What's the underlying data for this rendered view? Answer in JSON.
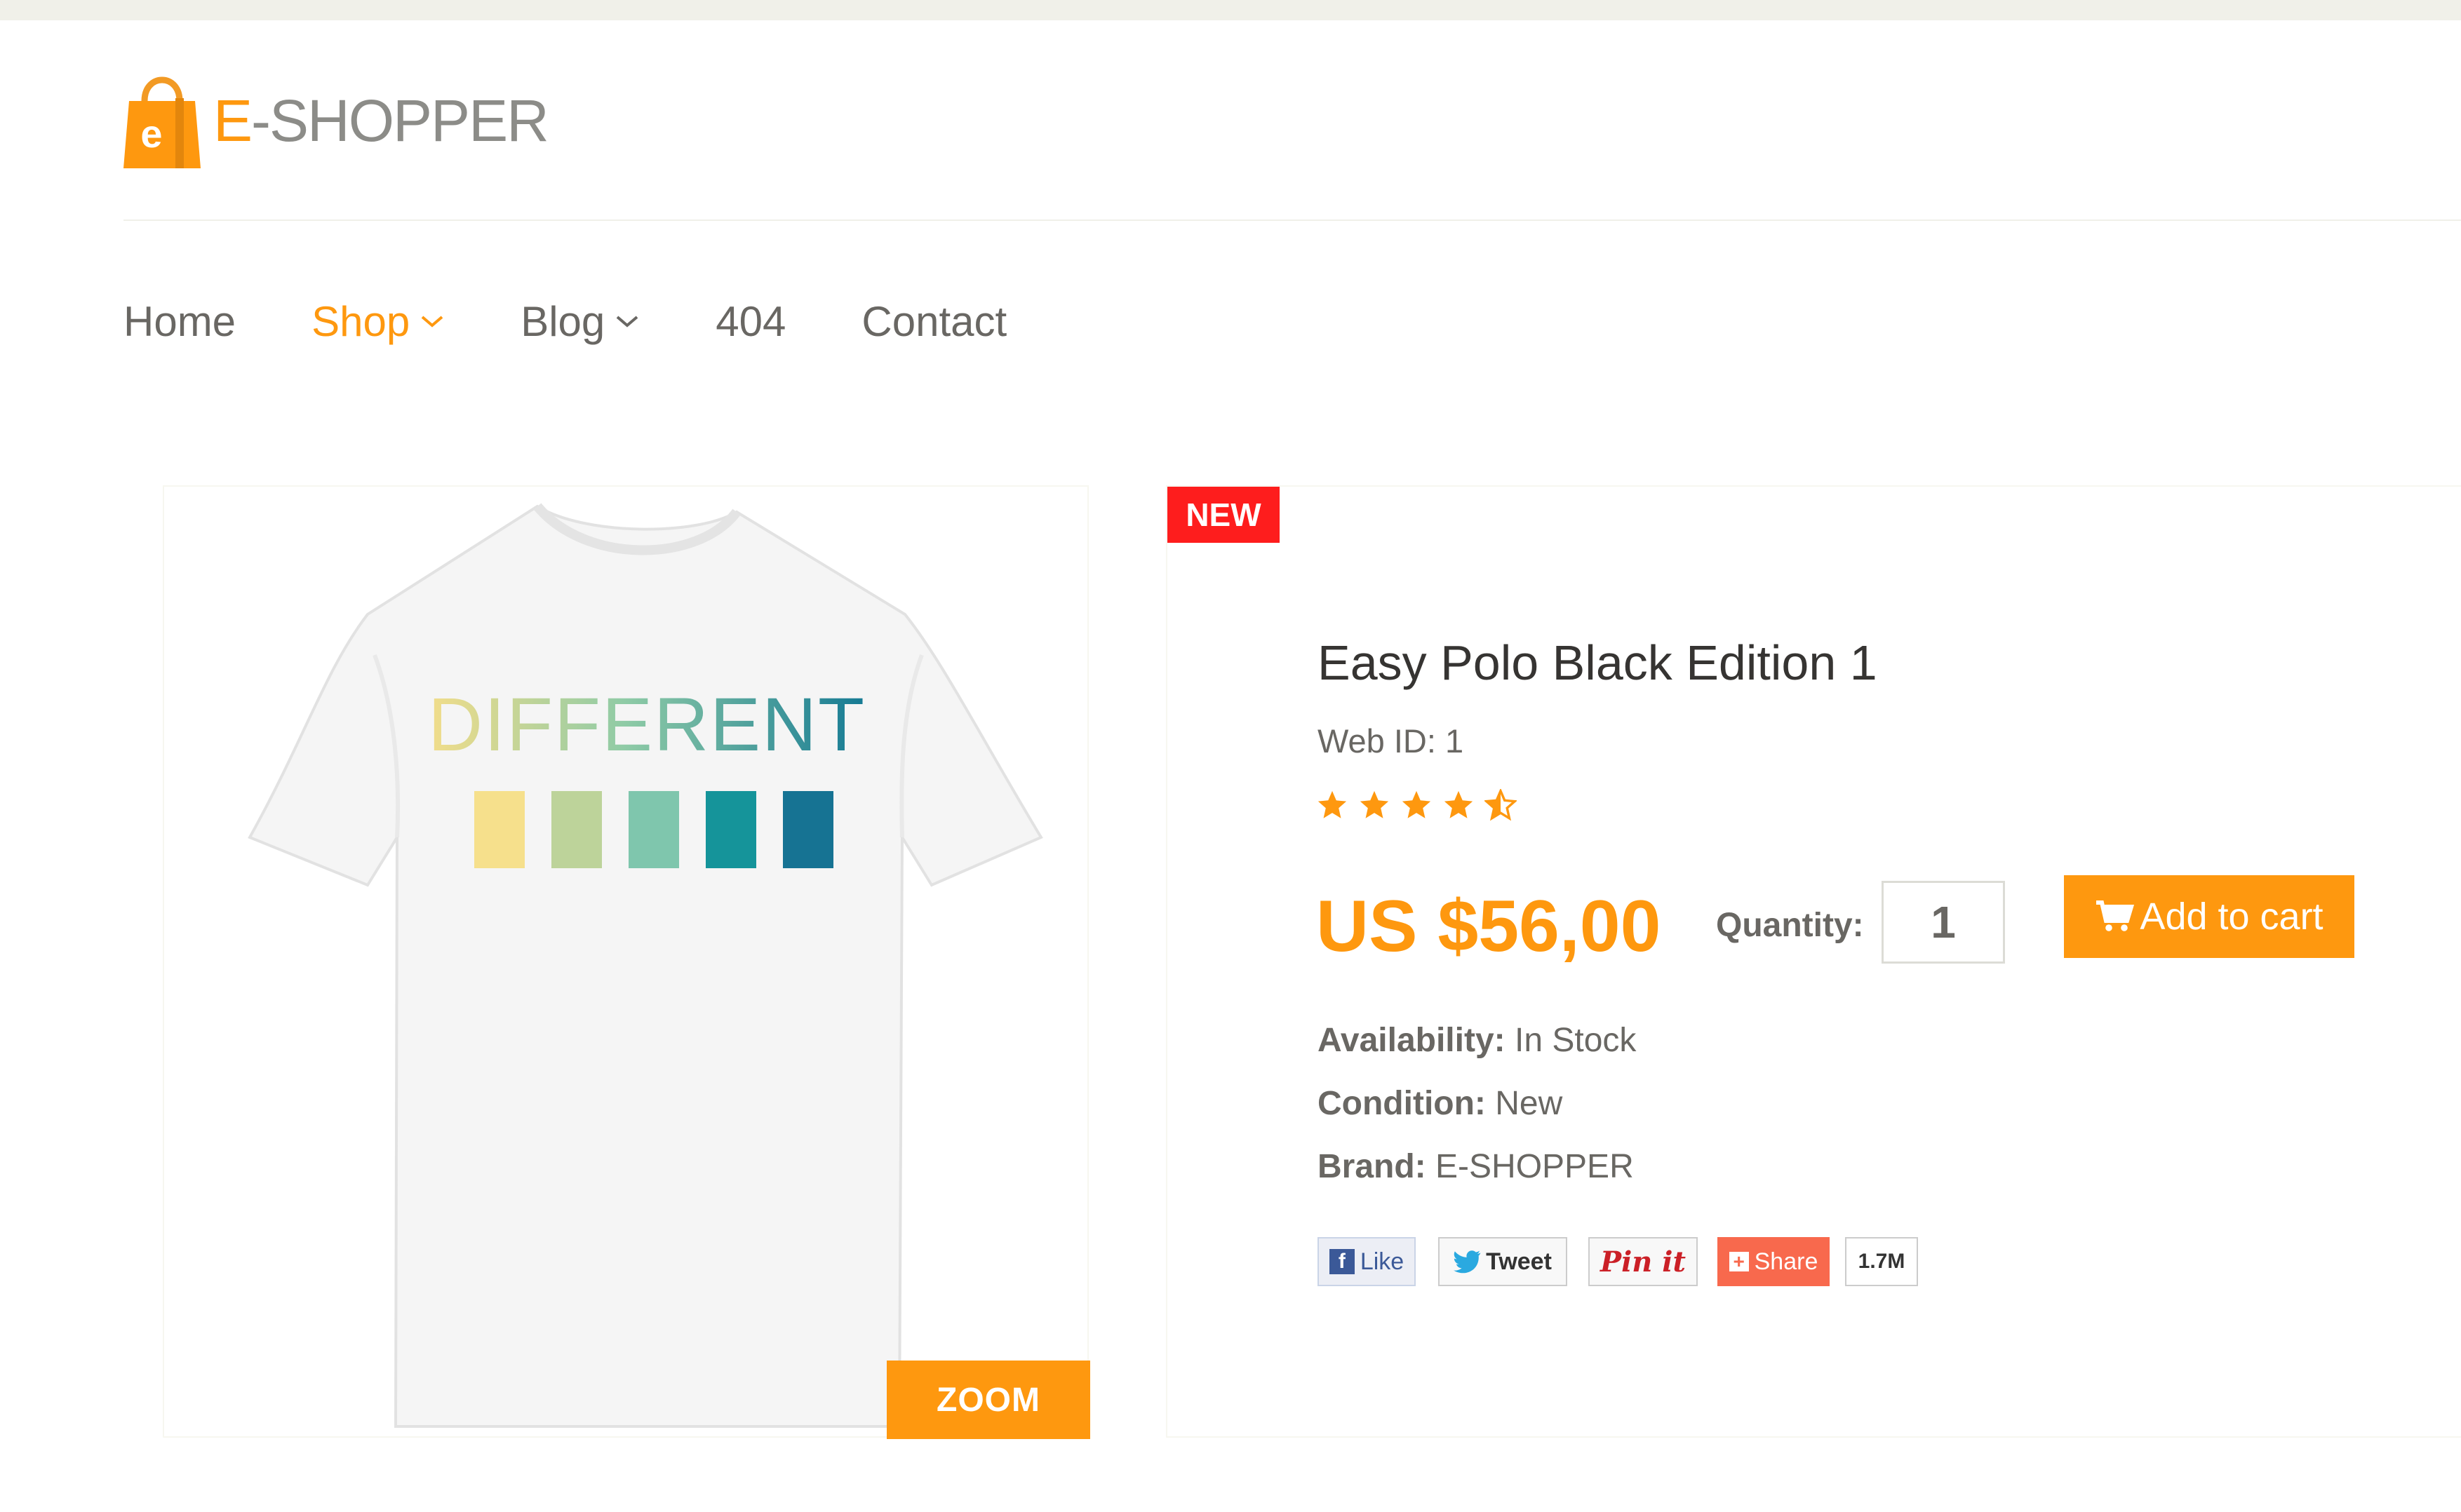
{
  "logo": {
    "letter": "e",
    "text_prefix": "E",
    "text_rest": "-SHOPPER"
  },
  "nav": {
    "items": [
      {
        "label": "Home"
      },
      {
        "label": "Shop"
      },
      {
        "label": "Blog"
      },
      {
        "label": "404"
      },
      {
        "label": "Contact"
      }
    ]
  },
  "product": {
    "image_text": "DIFFERENT",
    "swatch_colors": [
      "#f6e08c",
      "#bdd39a",
      "#7fc6ad",
      "#15949a",
      "#167393"
    ],
    "zoom_label": "ZOOM",
    "badge": "NEW",
    "title": "Easy Polo Black Edition 1",
    "web_id": "Web ID: 1",
    "rating": 4.5,
    "price": "US $56,00",
    "quantity_label": "Quantity:",
    "quantity_value": "1",
    "add_to_cart_label": "Add to cart",
    "availability_label": "Availability:",
    "availability_value": " In Stock",
    "condition_label": "Condition:",
    "condition_value": " New",
    "brand_label": "Brand:",
    "brand_value": " E-SHOPPER"
  },
  "social": {
    "like_label": "Like",
    "tweet_label": "Tweet",
    "pin_label": "Pin it",
    "share_label": "Share",
    "share_count": "1.7M"
  },
  "colors": {
    "accent": "#fe980f",
    "badge": "#fe1d1d",
    "text": "#696763"
  }
}
